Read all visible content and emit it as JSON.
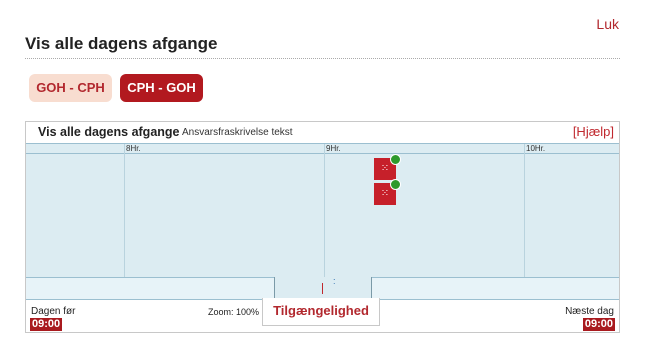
{
  "header": {
    "close_label": "Luk",
    "title": "Vis alle dagens afgange"
  },
  "routes": [
    {
      "label": "GOH - CPH",
      "active": false
    },
    {
      "label": "CPH - GOH",
      "active": true
    }
  ],
  "panel": {
    "title": "Vis alle dagens afgange",
    "subtitle": "Ansvarsfraskrivelse tekst",
    "help_label": "[Hjælp]"
  },
  "timeline": {
    "hours": [
      "8Hr.",
      "9Hr.",
      "10Hr."
    ],
    "flights": [
      {
        "icon": "flight-icon",
        "status": "on-time",
        "status_color": "#2e9a2c"
      },
      {
        "icon": "flight-icon",
        "status": "on-time",
        "status_color": "#2e9a2c"
      }
    ]
  },
  "footer": {
    "prev_label": "Dagen før",
    "prev_time": "09:00",
    "zoom_label": "Zoom: 100%",
    "availability_label": "Tilgængelighed",
    "next_label": "Næste dag",
    "next_time": "09:00"
  },
  "colors": {
    "accent": "#b2191f",
    "accent_light": "#f8ddd0",
    "timeline_bg": "#dcecf2"
  }
}
